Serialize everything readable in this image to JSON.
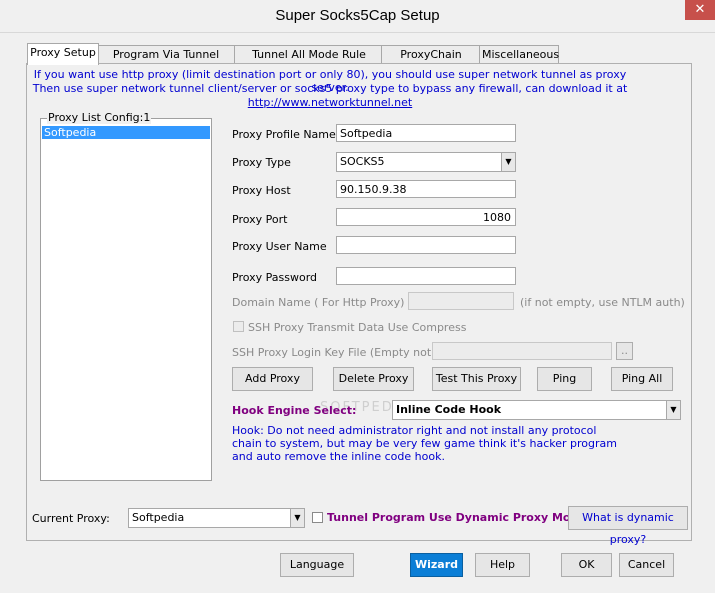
{
  "window": {
    "title": "Super Socks5Cap Setup",
    "close_glyph": "✕"
  },
  "tabs": [
    {
      "label": "Proxy Setup",
      "active": true
    },
    {
      "label": "Program Via Tunnel Config",
      "active": false
    },
    {
      "label": "Tunnel All Mode Rule Config",
      "active": false
    },
    {
      "label": "ProxyChain Config",
      "active": false
    },
    {
      "label": "Miscellaneous",
      "active": false
    }
  ],
  "info": {
    "line1": "If you want use http proxy (limit destination port or only 80), you should use super network tunnel as proxy server.",
    "line2": "Then use super network tunnel client/server or socks5 proxy type to bypass any firewall, can download it at",
    "link": "http://www.networktunnel.net"
  },
  "proxy_list": {
    "group_label": "Proxy List Config:1",
    "items": [
      "Softpedia"
    ]
  },
  "form": {
    "profile_name_label": "Proxy Profile Name",
    "profile_name_value": "Softpedia",
    "type_label": "Proxy Type",
    "type_value": "SOCKS5",
    "host_label": "Proxy Host",
    "host_value": "90.150.9.38",
    "port_label": "Proxy Port",
    "port_value": "1080",
    "user_label": "Proxy User Name",
    "user_value": "",
    "password_label": "Proxy Password",
    "password_value": "",
    "domain_label": "Domain Name ( For Http Proxy)",
    "domain_value": "",
    "domain_hint": "(if not empty, use NTLM auth)",
    "ssh_compress_label": "SSH Proxy Transmit Data Use Compress",
    "ssh_keyfile_label": "SSH Proxy Login Key File (Empty not use)",
    "ssh_keyfile_value": "",
    "browse_label": ".."
  },
  "buttons": {
    "add_proxy": "Add  Proxy",
    "delete_proxy": "Delete Proxy",
    "test_proxy": "Test This Proxy",
    "ping": "Ping",
    "ping_all": "Ping All"
  },
  "hook": {
    "label": "Hook Engine Select:",
    "value": "Inline Code Hook",
    "desc1": "Hook: Do not need administrator right and not install any protocol",
    "desc2": "chain to system, but may be very few game think it's hacker program",
    "desc3": "and auto remove the inline code hook."
  },
  "current_proxy": {
    "label": "Current Proxy:",
    "value": "Softpedia",
    "dynamic_label": "Tunnel Program Use Dynamic Proxy Mode",
    "dynamic_help": "What is dynamic proxy?"
  },
  "footer": {
    "language": "Language",
    "wizard": "Wizard",
    "help": "Help",
    "ok": "OK",
    "cancel": "Cancel"
  },
  "watermark": "SOFTPEDIA",
  "colors": {
    "selection": "#3399ff",
    "info_text": "#0000d0",
    "hook_label": "#800080",
    "wizard_button": "#0b7ed6",
    "close_button": "#c7504b"
  }
}
